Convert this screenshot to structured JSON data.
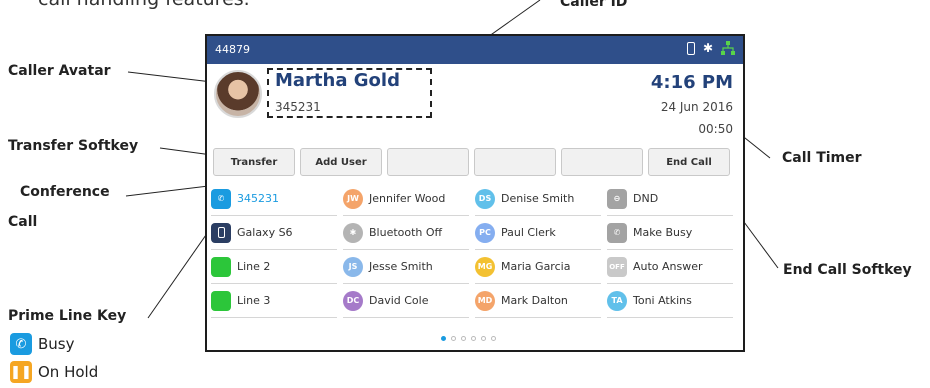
{
  "header": {
    "intro_fragment": "call handling features.",
    "caller_id_callout": "Caller ID"
  },
  "callouts": {
    "caller_avatar": "Caller Avatar",
    "transfer_softkey": "Transfer Softkey",
    "conference_call_1": "Conference",
    "conference_call_2": "Call",
    "prime_line_key": "Prime Line Key",
    "call_timer": "Call Timer",
    "end_call_softkey": "End Call Softkey"
  },
  "legend": [
    {
      "label": "Busy",
      "icon": "phone-icon",
      "color": "#1a9be0"
    },
    {
      "label": "On Hold",
      "icon": "pause-icon",
      "color": "#f5a623"
    }
  ],
  "phone": {
    "extension": "44879",
    "status_icons": [
      "handset-icon",
      "bluetooth-icon",
      "network-icon"
    ],
    "caller_name": "Martha Gold",
    "caller_number": "345231",
    "time": "4:16 PM",
    "date": "24 Jun 2016",
    "timer": "00:50",
    "softkeys": [
      "Transfer",
      "Add User",
      "",
      "",
      "",
      "End Call"
    ],
    "line_keys": [
      [
        {
          "label": "345231",
          "icon": "phone-icon",
          "color": "#1a9be0",
          "active": true
        },
        {
          "label": "Galaxy S6",
          "icon": "mobile-icon",
          "color": "#2b3e63"
        },
        {
          "label": "Line 2",
          "icon": "line-icon",
          "color": "#2cc63a"
        },
        {
          "label": "Line 3",
          "icon": "line-icon",
          "color": "#2cc63a"
        }
      ],
      [
        {
          "label": "Jennifer Wood",
          "icon": "avatar-jw",
          "initials": "JW",
          "color": "#f4a46a"
        },
        {
          "label": "Bluetooth Off",
          "icon": "bluetooth-icon",
          "initials": "✱",
          "color": "#b4b4b4"
        },
        {
          "label": "Jesse Smith",
          "icon": "avatar-js",
          "initials": "JS",
          "color": "#8ab8ea"
        },
        {
          "label": "David Cole",
          "icon": "avatar-dc",
          "initials": "DC",
          "color": "#a57ac9"
        }
      ],
      [
        {
          "label": "Denise Smith",
          "icon": "avatar-ds",
          "initials": "DS",
          "color": "#61c0ea"
        },
        {
          "label": "Paul Clerk",
          "icon": "avatar-pc",
          "initials": "PC",
          "color": "#85aef0"
        },
        {
          "label": "Maria Garcia",
          "icon": "avatar-mg",
          "initials": "MG",
          "color": "#f3c132"
        },
        {
          "label": "Mark Dalton",
          "icon": "avatar-md",
          "initials": "MD",
          "color": "#f4a46a"
        }
      ],
      [
        {
          "label": "DND",
          "icon": "dnd-icon",
          "initials": "⊖",
          "color": "#a3a3a3"
        },
        {
          "label": "Make Busy",
          "icon": "make-busy-icon",
          "initials": "✆",
          "color": "#a3a3a3"
        },
        {
          "label": "Auto Answer",
          "icon": "auto-answer-icon",
          "initials": "OFF",
          "color": "#c9c9c9"
        },
        {
          "label": "Toni Atkins",
          "icon": "avatar-ta",
          "initials": "TA",
          "color": "#61c0ea"
        }
      ]
    ],
    "pages": 6,
    "current_page": 1
  }
}
